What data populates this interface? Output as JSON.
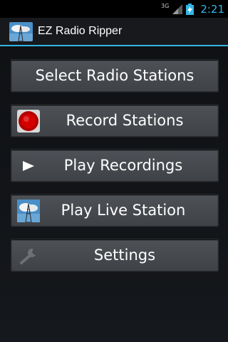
{
  "status_bar": {
    "network_type": "3G",
    "time": "2:21",
    "icons": [
      "signal-icon",
      "battery-charging-icon"
    ]
  },
  "action_bar": {
    "title": "EZ Radio Ripper",
    "icon": "radio-tower-icon"
  },
  "menu": {
    "buttons": [
      {
        "label": "Select Radio Stations",
        "icon": null
      },
      {
        "label": "Record Stations",
        "icon": "record-icon"
      },
      {
        "label": "Play Recordings",
        "icon": "play-icon"
      },
      {
        "label": "Play Live Station",
        "icon": "radio-tower-icon"
      },
      {
        "label": "Settings",
        "icon": "wrench-icon"
      }
    ]
  },
  "colors": {
    "accent": "#33b5e5",
    "background": "#101317",
    "button": "#4a4d51",
    "record_red": "#c00000"
  }
}
